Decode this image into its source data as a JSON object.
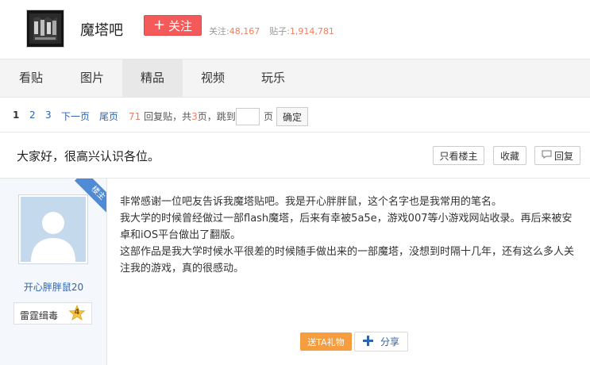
{
  "header": {
    "forum_name": "魔塔吧",
    "follow_label": "关注",
    "follow_plus": "+",
    "stats": {
      "followers_label": "关注:",
      "followers_value": "48,167",
      "posts_label": "贴子:",
      "posts_value": "1,914,781"
    }
  },
  "nav": {
    "tabs": [
      {
        "label": "看贴"
      },
      {
        "label": "图片"
      },
      {
        "label": "精品"
      },
      {
        "label": "视频"
      },
      {
        "label": "玩乐"
      }
    ]
  },
  "pager": {
    "pages": [
      "1",
      "2",
      "3"
    ],
    "next": "下一页",
    "last": "尾页",
    "reply_count": "71",
    "reply_text": "回复贴，共",
    "total_pages": "3",
    "pages_unit": "页，跳到",
    "page_unit": "页",
    "confirm": "确定"
  },
  "thread": {
    "title": "大家好，很高兴认识各位。",
    "only_author": "只看楼主",
    "collect": "收藏",
    "reply": "回复"
  },
  "post": {
    "ribbon": "楼主",
    "username": "开心胖胖鼠20",
    "badge_name": "雷霆缉毒",
    "badge_level": "4",
    "paragraphs": [
      "非常感谢一位吧友告诉我魔塔贴吧。我是开心胖胖鼠，这个名字也是我常用的笔名。",
      "我大学的时候曾经做过一部flash魔塔，后来有幸被5a5e，游戏007等小游戏网站收录。再后来被安卓和iOS平台做出了翻版。",
      "这部作品是我大学时候水平很差的时候随手做出来的一部魔塔，没想到时隔十几年，还有这么多人关注我的游戏，真的很感动。"
    ],
    "gift_label": "送TA礼物",
    "share_label": "分享"
  }
}
